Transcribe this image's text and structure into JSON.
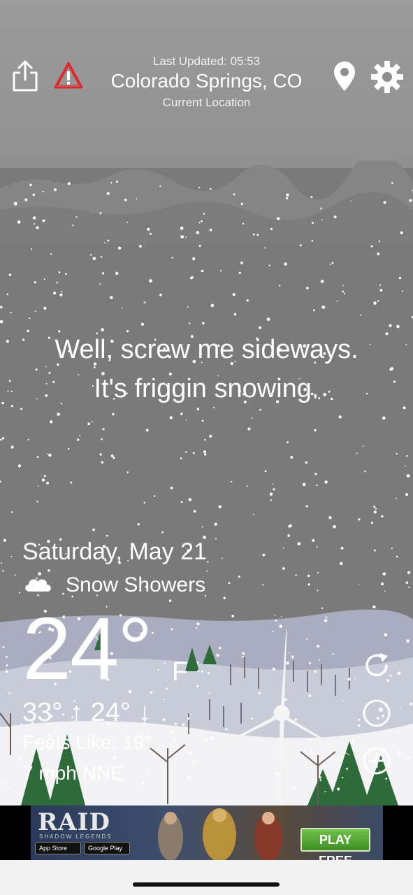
{
  "header": {
    "last_updated": "Last Updated: 05:53",
    "city": "Colorado Springs, CO",
    "location_label": "Current Location"
  },
  "icons": {
    "share": "share-icon",
    "alert": "alert-triangle-icon",
    "location": "map-pin-icon",
    "settings": "gear-icon",
    "condition": "snow-cloud-icon",
    "refresh": "refresh-icon",
    "radar": "radar-icon",
    "add": "add-icon"
  },
  "message": {
    "line1": "Well, screw me sideways.",
    "line2": "It's friggin snowing."
  },
  "weather": {
    "date": "Saturday, May 21",
    "condition": "Snow Showers",
    "temperature": "24°",
    "unit": "F",
    "high_low": "33° ↑ 24° ↓",
    "feels_like": "Feels Like: 19°",
    "wind": "7 mph NNE"
  },
  "ad": {
    "logo": "RAID",
    "subtitle": "SHADOW LEGENDS",
    "app_store": "App Store",
    "google_play": "Google Play",
    "cta": "PLAY FREE"
  },
  "colors": {
    "sky": "#7a7a7a",
    "alert": "#e0262a",
    "ad_cta": "#4fa832"
  }
}
